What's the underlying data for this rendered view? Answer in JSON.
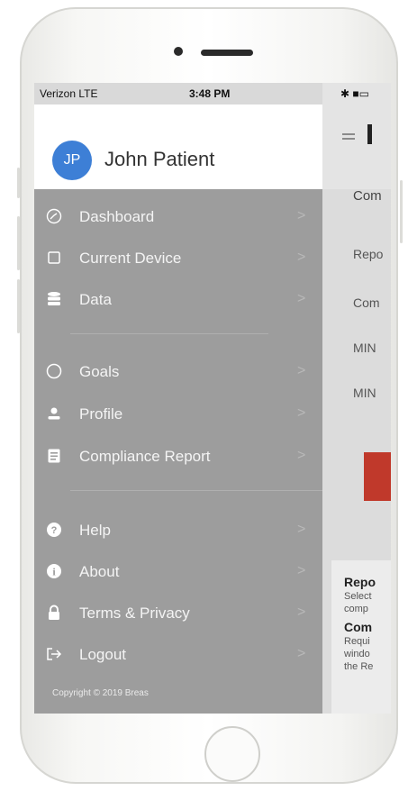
{
  "status_bar": {
    "carrier": "Verizon  LTE",
    "time": "3:48 PM",
    "battery": "✱ ■▭"
  },
  "user": {
    "initials": "JP",
    "name": "John Patient"
  },
  "menu": {
    "items": [
      {
        "label": "Dashboard",
        "icon": "dashboard-gauge-icon"
      },
      {
        "label": "Current Device",
        "icon": "device-icon"
      },
      {
        "label": "Data",
        "icon": "database-icon"
      },
      {
        "label": "Goals",
        "icon": "goals-circle-icon"
      },
      {
        "label": "Profile",
        "icon": "person-icon"
      },
      {
        "label": "Compliance Report",
        "icon": "report-icon"
      },
      {
        "label": "Help",
        "icon": "help-icon"
      },
      {
        "label": "About",
        "icon": "info-icon"
      },
      {
        "label": "Terms & Privacy",
        "icon": "lock-icon"
      },
      {
        "label": "Logout",
        "icon": "logout-icon"
      }
    ],
    "chevron": ">"
  },
  "copyright": "Copyright © 2019 Breas",
  "background_app": {
    "title_fragment": "Com",
    "rows": [
      "Repo",
      "Com",
      "MIN",
      "MIN"
    ],
    "bottom_heading_1": "Repo",
    "bottom_text_1a": "Select",
    "bottom_text_1b": "comp",
    "bottom_heading_2": "Com",
    "bottom_text_2a": "Requi",
    "bottom_text_2b": "windo",
    "bottom_text_2c": "the Re"
  },
  "colors": {
    "drawer": "#9d9d9d",
    "avatar": "#3d7fd6",
    "accent_red": "#c0392b"
  }
}
